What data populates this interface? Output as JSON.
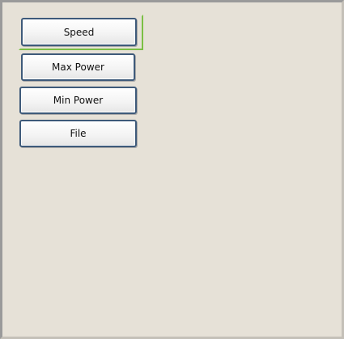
{
  "buttons": {
    "speed": "Speed",
    "max_power": "Max Power",
    "min_power": "Min Power",
    "file": "File"
  },
  "colors": {
    "panel_background": "#e6e1d7",
    "button_border": "#3e5a7a",
    "focus_ring": "#7bbf44"
  }
}
